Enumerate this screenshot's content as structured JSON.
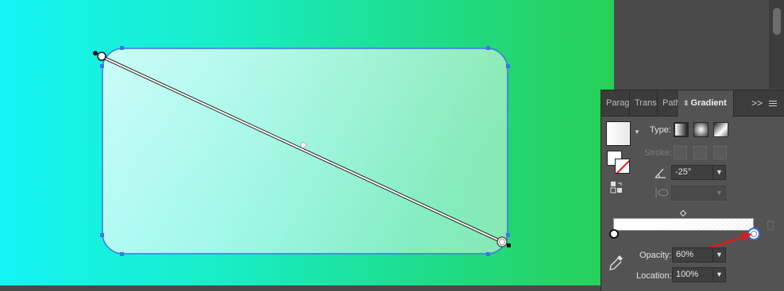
{
  "panel": {
    "tabs": [
      {
        "label": "Parag",
        "active": false
      },
      {
        "label": "Trans",
        "active": false
      },
      {
        "label": "Pathfi",
        "active": false
      },
      {
        "label": "Gradient",
        "active": true
      }
    ],
    "more_label": ">>",
    "type_label": "Type:",
    "stroke_label": "Stroke:",
    "angle_value": "-25°",
    "aspect_value": "",
    "opacity_label": "Opacity:",
    "opacity_value": "60%",
    "location_label": "Location:",
    "location_value": "100%"
  },
  "colors": {
    "canvas_gradient_start": "#14f4f4",
    "canvas_gradient_end": "#28cf55",
    "selection_blue": "#3a78e0",
    "arrow_red": "#d42020",
    "panel_bg": "#535353"
  },
  "icons": {
    "tab_arrows": "⇕",
    "trash": "trash-icon",
    "eyedropper": "eyedropper-icon",
    "reverse": "reverse-gradient-icon",
    "angle": "angle-icon",
    "aspect": "aspect-ratio-icon"
  }
}
